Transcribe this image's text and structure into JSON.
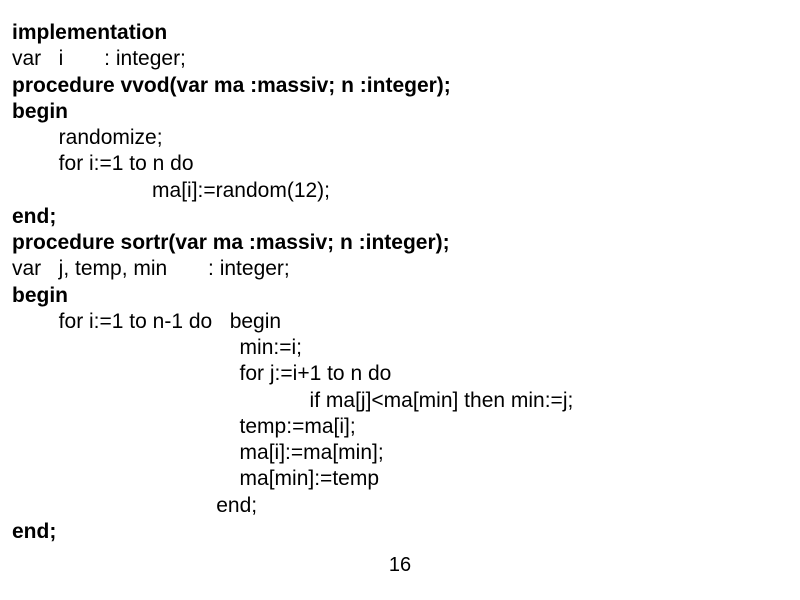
{
  "lines": [
    {
      "text": "implementation",
      "bold": true
    },
    {
      "text": "var   i       : integer;"
    },
    {
      "text": "procedure vvod(var ma :massiv; n :integer);",
      "bold": true
    },
    {
      "text": "begin",
      "bold": true
    },
    {
      "text": "        randomize;"
    },
    {
      "text": "        for i:=1 to n do"
    },
    {
      "text": "                        ma[i]:=random(12);"
    },
    {
      "text": "end;",
      "bold": true
    },
    {
      "text": "procedure sortr(var ma :massiv; n :integer);",
      "bold": true
    },
    {
      "text": "var   j, temp, min       : integer;"
    },
    {
      "text": "begin",
      "bold": true
    },
    {
      "text": "        for i:=1 to n-1 do   begin"
    },
    {
      "text": "                                       min:=i;"
    },
    {
      "text": "                                       for j:=i+1 to n do"
    },
    {
      "text": "                                                   if ma[j]<ma[min] then min:=j;"
    },
    {
      "text": "                                       temp:=ma[i];"
    },
    {
      "text": "                                       ma[i]:=ma[min];"
    },
    {
      "text": "                                       ma[min]:=temp"
    },
    {
      "text": "                                   end;"
    },
    {
      "text": "end;",
      "bold": true
    }
  ],
  "page_number": "16"
}
